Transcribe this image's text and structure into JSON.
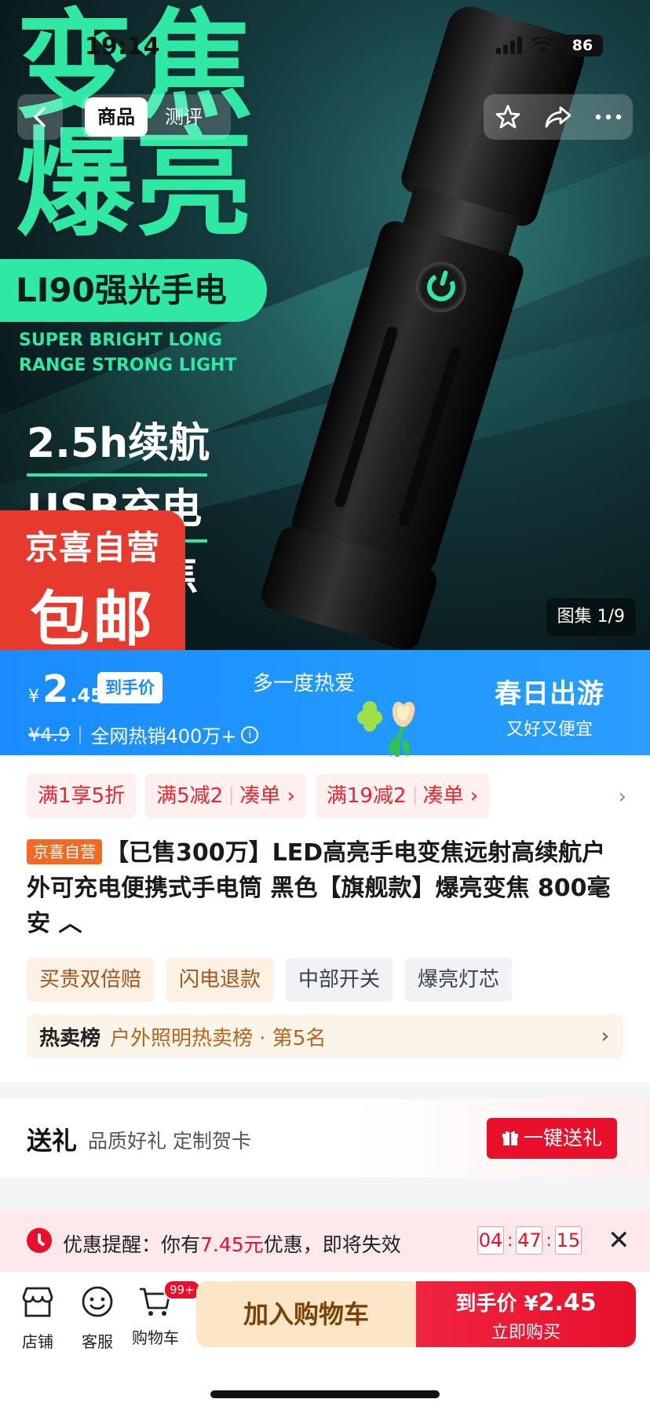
{
  "status_bar": {
    "time": "19:14",
    "battery": "86"
  },
  "top_nav": {
    "tabs": [
      "商品",
      "测评"
    ],
    "active_tab": 0
  },
  "hero": {
    "headline_1": "变焦",
    "headline_2": "爆亮",
    "model": "LI90强光手电",
    "english_1": "SUPER BRIGHT LONG",
    "english_2": "RANGE STRONG LIGHT",
    "feature_1": "2.5h续航",
    "feature_2": "USB充电",
    "feature_3": "焦",
    "badge_line1": "京喜自营",
    "badge_line2": "包邮",
    "gallery_counter": "图集 1/9"
  },
  "price_banner": {
    "currency": "¥",
    "price_int": "2",
    "price_dec": ".45",
    "price_tag": "到手价",
    "original_price": "¥4.9",
    "sales": "全网热销400万+",
    "info_icon": "i",
    "slogan": "多一度热爱",
    "promo_title": "春日出游",
    "promo_sub": "又好又便宜",
    "colors": {
      "bg": "#1a8cff"
    }
  },
  "promos": [
    {
      "text": "满1享5折",
      "action": ""
    },
    {
      "text": "满5减2",
      "action": "凑单 ›"
    },
    {
      "text": "满19减2",
      "action": "凑单 ›"
    }
  ],
  "promos_more": "›",
  "product": {
    "badge": "京喜自营",
    "title": "【已售300万】LED高亮手电变焦远射高续航户外可充电便携式手电筒 黑色【旗舰款】爆亮变焦 800毫安 ︿",
    "tags": [
      "买贵双倍赔",
      "闪电退款",
      "中部开关",
      "爆亮灯芯"
    ]
  },
  "rank": {
    "label": "热卖榜",
    "value": "户外照明热卖榜 · 第5名",
    "arrow": "›"
  },
  "gift": {
    "title": "送礼",
    "subtitle": "品质好礼 定制贺卡",
    "button": "一键送礼"
  },
  "reminder": {
    "prefix": "优惠提醒：你有",
    "amount": "7.45元",
    "suffix": "优惠，即将失效",
    "timer": [
      "04",
      "47",
      "15"
    ],
    "close": "✕"
  },
  "bottom_bar": {
    "shop": "店铺",
    "service": "客服",
    "cart": "购物车",
    "cart_badge": "99+",
    "add_to_cart": "加入购物车",
    "buy_price_label": "到手价",
    "buy_currency": "¥",
    "buy_amount": "2.45",
    "buy_now": "立即购买"
  }
}
